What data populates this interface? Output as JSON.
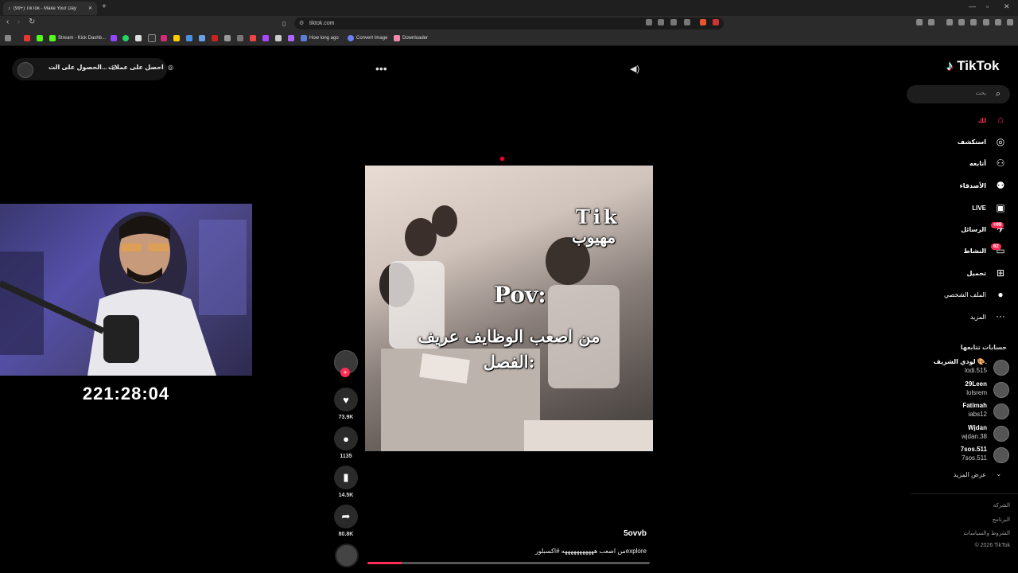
{
  "browser": {
    "tab_title": "(99+) TikTok - Make Your Day",
    "address": "tiktok.com",
    "bookmarks": [
      "Stream - Kick Dashb...",
      "How long ago",
      "Convert Image",
      "Downloader"
    ]
  },
  "topbar": {
    "get_coins": "احصل على عملات",
    "get_app": "الحصول على الت..."
  },
  "stream": {
    "timer": "221:28:04"
  },
  "video": {
    "overlay_tik": "Tik",
    "overlay_scared": "مهيوب",
    "overlay_pov": "Pov:",
    "overlay_line1": "من اصعب الوظايف عريف",
    "overlay_line2": "الفصل:",
    "progress_fraction": 0.12
  },
  "actions": {
    "likes": "73.9K",
    "comments": "1135",
    "saves": "14.5K",
    "shares": "80.8K"
  },
  "post": {
    "username": "5ovvb",
    "caption": "من اصعب هههههههههههه #اكسبلورexplore"
  },
  "sidebar": {
    "logo": "TikTok",
    "search_placeholder": "بحث",
    "nav": [
      {
        "label": "لك",
        "icon": "home-icon",
        "active": true
      },
      {
        "label": "استكشف",
        "icon": "compass-icon"
      },
      {
        "label": "أتابعه",
        "icon": "following-icon"
      },
      {
        "label": "الأصدقاء",
        "icon": "friends-icon"
      },
      {
        "label": "LIVE",
        "icon": "live-icon"
      },
      {
        "label": "الرسائل",
        "icon": "messages-icon",
        "badge": "+99"
      },
      {
        "label": "النشاط",
        "icon": "activity-icon",
        "badge": "62"
      },
      {
        "label": "تحميل",
        "icon": "upload-icon"
      },
      {
        "label": "الملف الشخصي",
        "icon": "profile-icon"
      },
      {
        "label": "المزيد",
        "icon": "more-icon"
      }
    ],
    "following_title": "حسابات تتابعها",
    "accounts": [
      {
        "name": "لودي الشريف 🎨.",
        "handle": "lodi.515"
      },
      {
        "name": "29Leen",
        "handle": "lolsrem"
      },
      {
        "name": "Fatimah",
        "handle": "iabs12"
      },
      {
        "name": "Wjdan",
        "handle": "wjdan.38"
      },
      {
        "name": "7sos.511",
        "handle": "7sos.511"
      }
    ],
    "see_more": "عرض المزيد",
    "footer": [
      "الشركة",
      "البرنامج",
      "الشروط والسياسات",
      "© 2026 TikTok"
    ]
  },
  "colors": {
    "accent": "#fe2c55",
    "background": "#000000"
  }
}
